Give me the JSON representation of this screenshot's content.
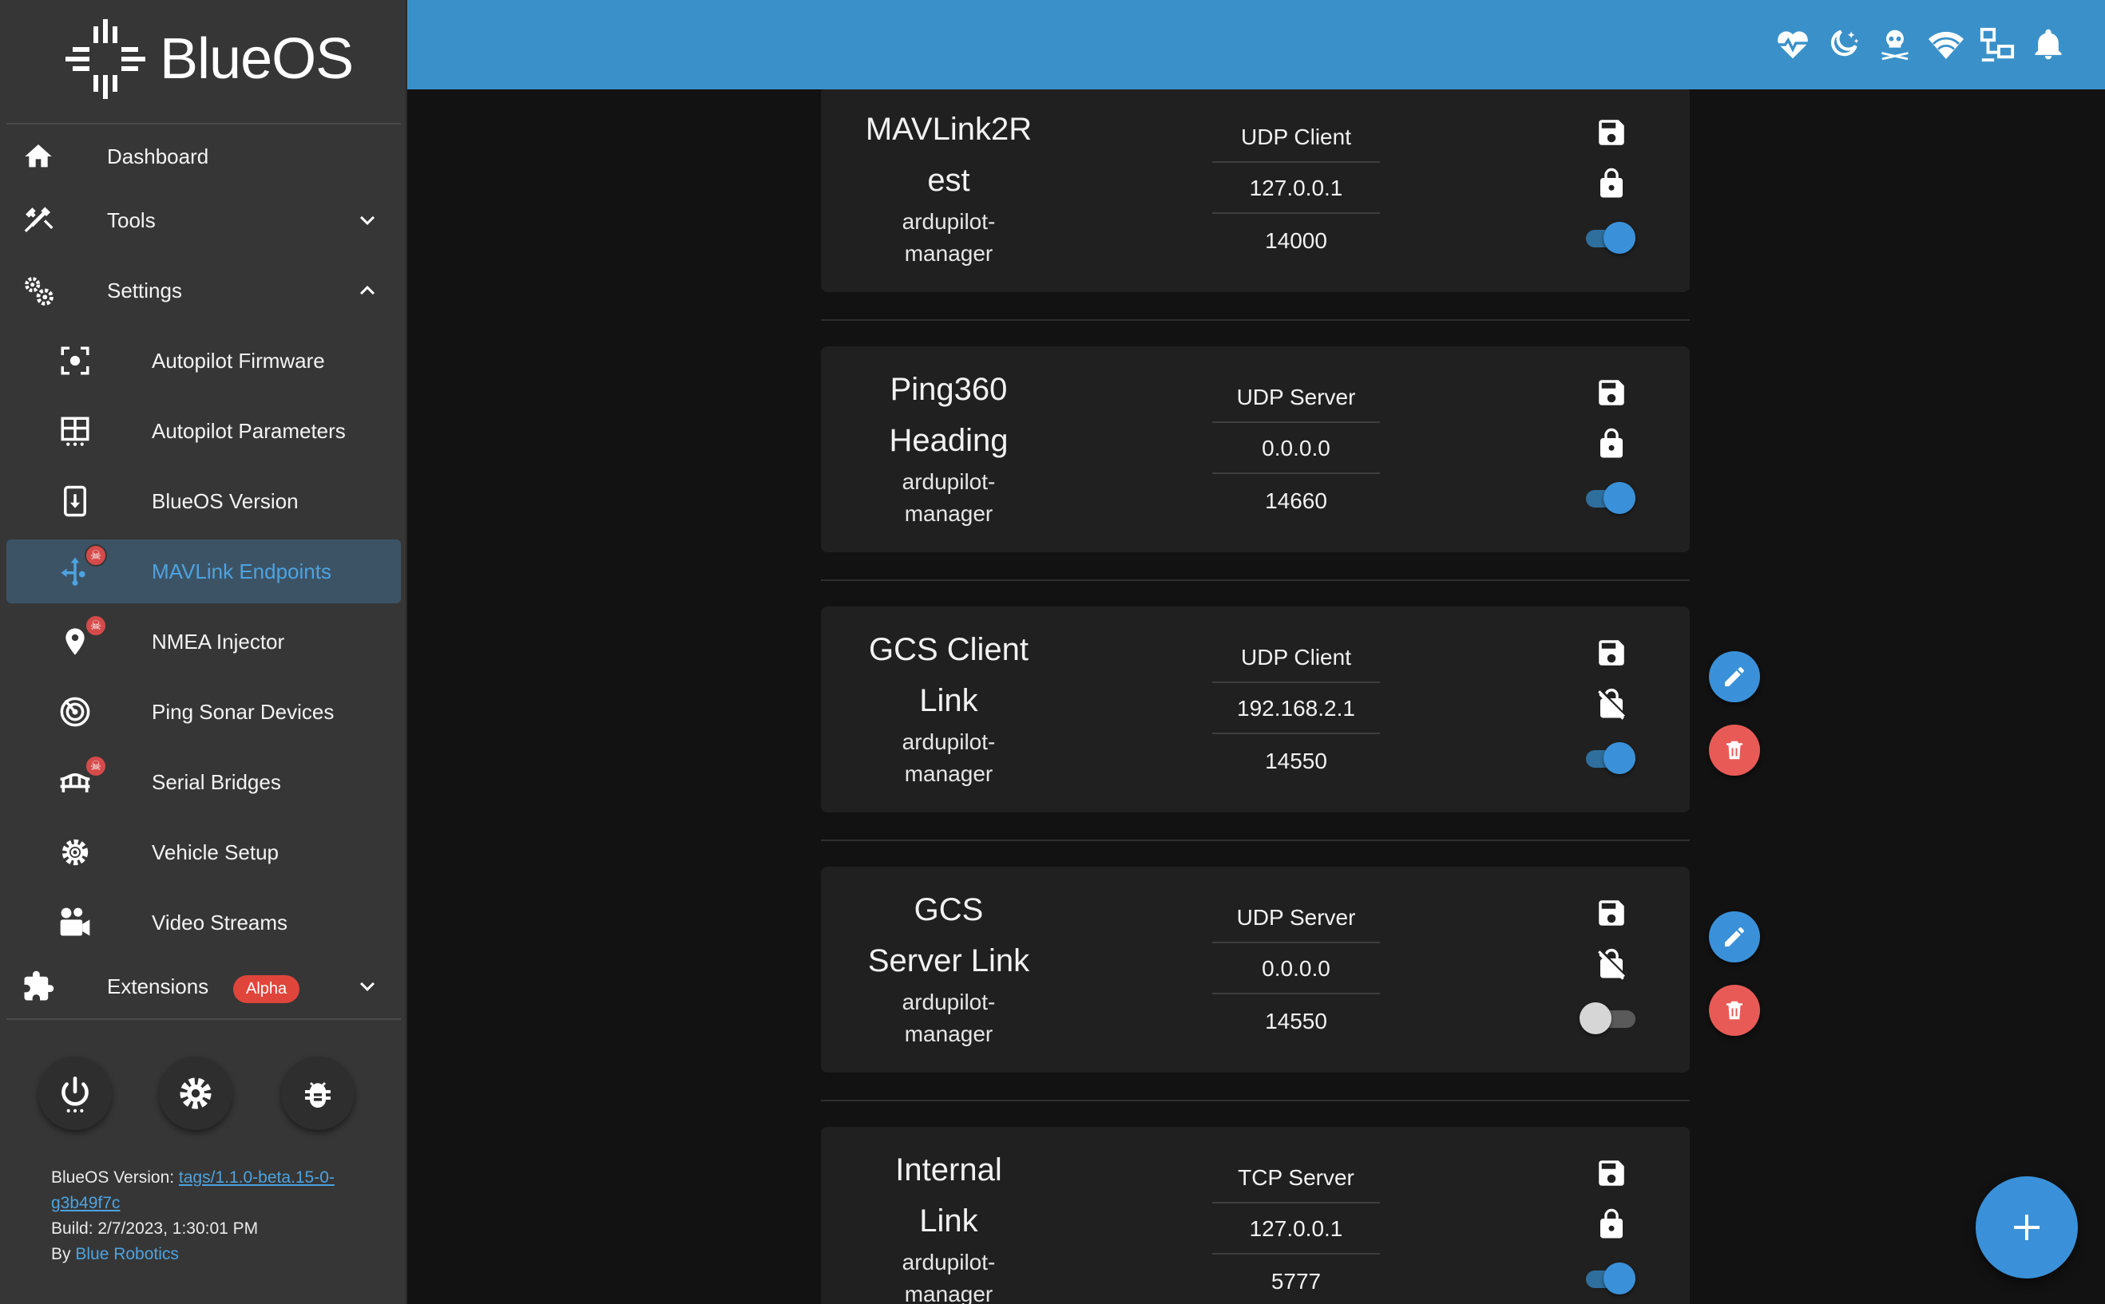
{
  "app": {
    "name": "BlueOS"
  },
  "sidebar": {
    "items": [
      {
        "label": "Dashboard",
        "icon": "home-icon"
      },
      {
        "label": "Tools",
        "icon": "tools-icon",
        "expanded": false
      },
      {
        "label": "Settings",
        "icon": "settings-icon",
        "expanded": true
      },
      {
        "label": "Autopilot Firmware",
        "icon": "autopilot-firmware-icon"
      },
      {
        "label": "Autopilot Parameters",
        "icon": "table-icon"
      },
      {
        "label": "BlueOS Version",
        "icon": "download-icon"
      },
      {
        "label": "MAVLink Endpoints",
        "icon": "mavlink-endpoints-icon",
        "active": true
      },
      {
        "label": "NMEA Injector",
        "icon": "map-marker-icon"
      },
      {
        "label": "Ping Sonar Devices",
        "icon": "sonar-icon"
      },
      {
        "label": "Serial Bridges",
        "icon": "bridge-icon"
      },
      {
        "label": "Vehicle Setup",
        "icon": "gear-icon"
      },
      {
        "label": "Video Streams",
        "icon": "video-camera-icon"
      },
      {
        "label": "Extensions",
        "icon": "puzzle-icon",
        "badge": "Alpha",
        "expanded": false
      }
    ],
    "footer": {
      "version_label": "BlueOS Version: ",
      "version_link": "tags/1.1.0-beta.15-0-g3b49f7c",
      "build": "Build: 2/7/2023, 1:30:01 PM",
      "by_label": "By ",
      "by_link": "Blue Robotics"
    }
  },
  "appbar": {
    "icons": [
      "heartbeat-icon",
      "night-mode-icon",
      "pirate-mode-icon",
      "wifi-icon",
      "network-icon",
      "notifications-bell-icon"
    ]
  },
  "endpoints": [
    {
      "name_line1": "MAVLink2R",
      "name_line2": "est",
      "owner_line1": "ardupilot-",
      "owner_line2": "manager",
      "type": "UDP Client",
      "ip": "127.0.0.1",
      "port": "14000",
      "protected": true,
      "enabled": true,
      "editable": false
    },
    {
      "name_line1": "Ping360",
      "name_line2": "Heading",
      "owner_line1": "ardupilot-",
      "owner_line2": "manager",
      "type": "UDP Server",
      "ip": "0.0.0.0",
      "port": "14660",
      "protected": true,
      "enabled": true,
      "editable": false
    },
    {
      "name_line1": "GCS Client",
      "name_line2": "Link",
      "owner_line1": "ardupilot-",
      "owner_line2": "manager",
      "type": "UDP Client",
      "ip": "192.168.2.1",
      "port": "14550",
      "protected": false,
      "enabled": true,
      "editable": true
    },
    {
      "name_line1": "GCS",
      "name_line2": "Server Link",
      "owner_line1": "ardupilot-",
      "owner_line2": "manager",
      "type": "UDP Server",
      "ip": "0.0.0.0",
      "port": "14550",
      "protected": false,
      "enabled": false,
      "editable": true
    },
    {
      "name_line1": "Internal",
      "name_line2": "Link",
      "owner_line1": "ardupilot-",
      "owner_line2": "manager",
      "type": "TCP Server",
      "ip": "127.0.0.1",
      "port": "5777",
      "protected": true,
      "enabled": true,
      "editable": false
    }
  ],
  "colors": {
    "accent": "#3a91c9",
    "active_text": "#4da3e0",
    "delete": "#e85a56",
    "badge": "#e0453b"
  }
}
